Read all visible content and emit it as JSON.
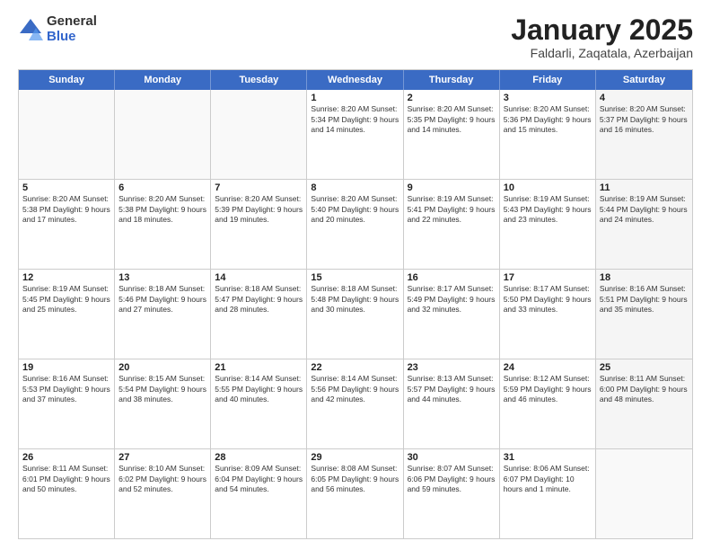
{
  "logo": {
    "general": "General",
    "blue": "Blue"
  },
  "title": "January 2025",
  "subtitle": "Faldarli, Zaqatala, Azerbaijan",
  "header_days": [
    "Sunday",
    "Monday",
    "Tuesday",
    "Wednesday",
    "Thursday",
    "Friday",
    "Saturday"
  ],
  "weeks": [
    [
      {
        "day": "",
        "info": "",
        "empty": true
      },
      {
        "day": "",
        "info": "",
        "empty": true
      },
      {
        "day": "",
        "info": "",
        "empty": true
      },
      {
        "day": "1",
        "info": "Sunrise: 8:20 AM\nSunset: 5:34 PM\nDaylight: 9 hours\nand 14 minutes.",
        "empty": false
      },
      {
        "day": "2",
        "info": "Sunrise: 8:20 AM\nSunset: 5:35 PM\nDaylight: 9 hours\nand 14 minutes.",
        "empty": false
      },
      {
        "day": "3",
        "info": "Sunrise: 8:20 AM\nSunset: 5:36 PM\nDaylight: 9 hours\nand 15 minutes.",
        "empty": false
      },
      {
        "day": "4",
        "info": "Sunrise: 8:20 AM\nSunset: 5:37 PM\nDaylight: 9 hours\nand 16 minutes.",
        "empty": false,
        "shaded": true
      }
    ],
    [
      {
        "day": "5",
        "info": "Sunrise: 8:20 AM\nSunset: 5:38 PM\nDaylight: 9 hours\nand 17 minutes.",
        "empty": false
      },
      {
        "day": "6",
        "info": "Sunrise: 8:20 AM\nSunset: 5:38 PM\nDaylight: 9 hours\nand 18 minutes.",
        "empty": false
      },
      {
        "day": "7",
        "info": "Sunrise: 8:20 AM\nSunset: 5:39 PM\nDaylight: 9 hours\nand 19 minutes.",
        "empty": false
      },
      {
        "day": "8",
        "info": "Sunrise: 8:20 AM\nSunset: 5:40 PM\nDaylight: 9 hours\nand 20 minutes.",
        "empty": false
      },
      {
        "day": "9",
        "info": "Sunrise: 8:19 AM\nSunset: 5:41 PM\nDaylight: 9 hours\nand 22 minutes.",
        "empty": false
      },
      {
        "day": "10",
        "info": "Sunrise: 8:19 AM\nSunset: 5:43 PM\nDaylight: 9 hours\nand 23 minutes.",
        "empty": false
      },
      {
        "day": "11",
        "info": "Sunrise: 8:19 AM\nSunset: 5:44 PM\nDaylight: 9 hours\nand 24 minutes.",
        "empty": false,
        "shaded": true
      }
    ],
    [
      {
        "day": "12",
        "info": "Sunrise: 8:19 AM\nSunset: 5:45 PM\nDaylight: 9 hours\nand 25 minutes.",
        "empty": false
      },
      {
        "day": "13",
        "info": "Sunrise: 8:18 AM\nSunset: 5:46 PM\nDaylight: 9 hours\nand 27 minutes.",
        "empty": false
      },
      {
        "day": "14",
        "info": "Sunrise: 8:18 AM\nSunset: 5:47 PM\nDaylight: 9 hours\nand 28 minutes.",
        "empty": false
      },
      {
        "day": "15",
        "info": "Sunrise: 8:18 AM\nSunset: 5:48 PM\nDaylight: 9 hours\nand 30 minutes.",
        "empty": false
      },
      {
        "day": "16",
        "info": "Sunrise: 8:17 AM\nSunset: 5:49 PM\nDaylight: 9 hours\nand 32 minutes.",
        "empty": false
      },
      {
        "day": "17",
        "info": "Sunrise: 8:17 AM\nSunset: 5:50 PM\nDaylight: 9 hours\nand 33 minutes.",
        "empty": false
      },
      {
        "day": "18",
        "info": "Sunrise: 8:16 AM\nSunset: 5:51 PM\nDaylight: 9 hours\nand 35 minutes.",
        "empty": false,
        "shaded": true
      }
    ],
    [
      {
        "day": "19",
        "info": "Sunrise: 8:16 AM\nSunset: 5:53 PM\nDaylight: 9 hours\nand 37 minutes.",
        "empty": false
      },
      {
        "day": "20",
        "info": "Sunrise: 8:15 AM\nSunset: 5:54 PM\nDaylight: 9 hours\nand 38 minutes.",
        "empty": false
      },
      {
        "day": "21",
        "info": "Sunrise: 8:14 AM\nSunset: 5:55 PM\nDaylight: 9 hours\nand 40 minutes.",
        "empty": false
      },
      {
        "day": "22",
        "info": "Sunrise: 8:14 AM\nSunset: 5:56 PM\nDaylight: 9 hours\nand 42 minutes.",
        "empty": false
      },
      {
        "day": "23",
        "info": "Sunrise: 8:13 AM\nSunset: 5:57 PM\nDaylight: 9 hours\nand 44 minutes.",
        "empty": false
      },
      {
        "day": "24",
        "info": "Sunrise: 8:12 AM\nSunset: 5:59 PM\nDaylight: 9 hours\nand 46 minutes.",
        "empty": false
      },
      {
        "day": "25",
        "info": "Sunrise: 8:11 AM\nSunset: 6:00 PM\nDaylight: 9 hours\nand 48 minutes.",
        "empty": false,
        "shaded": true
      }
    ],
    [
      {
        "day": "26",
        "info": "Sunrise: 8:11 AM\nSunset: 6:01 PM\nDaylight: 9 hours\nand 50 minutes.",
        "empty": false
      },
      {
        "day": "27",
        "info": "Sunrise: 8:10 AM\nSunset: 6:02 PM\nDaylight: 9 hours\nand 52 minutes.",
        "empty": false
      },
      {
        "day": "28",
        "info": "Sunrise: 8:09 AM\nSunset: 6:04 PM\nDaylight: 9 hours\nand 54 minutes.",
        "empty": false
      },
      {
        "day": "29",
        "info": "Sunrise: 8:08 AM\nSunset: 6:05 PM\nDaylight: 9 hours\nand 56 minutes.",
        "empty": false
      },
      {
        "day": "30",
        "info": "Sunrise: 8:07 AM\nSunset: 6:06 PM\nDaylight: 9 hours\nand 59 minutes.",
        "empty": false
      },
      {
        "day": "31",
        "info": "Sunrise: 8:06 AM\nSunset: 6:07 PM\nDaylight: 10 hours\nand 1 minute.",
        "empty": false
      },
      {
        "day": "",
        "info": "",
        "empty": true,
        "shaded": true
      }
    ]
  ]
}
